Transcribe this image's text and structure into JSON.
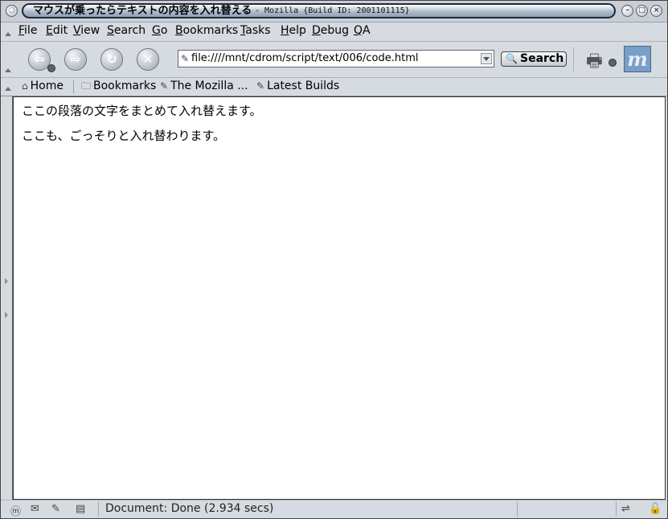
{
  "window": {
    "title": "マウスが乗ったらテキストの内容を入れ替える",
    "subtitle": "- Mozilla {Build ID: 2001101115}"
  },
  "menu": [
    {
      "label": "File",
      "accel": "F",
      "rest": "ile"
    },
    {
      "label": "Edit",
      "accel": "E",
      "rest": "dit"
    },
    {
      "label": "View",
      "accel": "V",
      "rest": "iew"
    },
    {
      "label": "Search",
      "accel": "S",
      "rest": "earch"
    },
    {
      "label": "Go",
      "accel": "G",
      "rest": "o"
    },
    {
      "label": "Bookmarks",
      "accel": "B",
      "rest": "ookmarks"
    },
    {
      "label": "Tasks",
      "accel": "T",
      "rest": "asks"
    },
    {
      "label": "Help",
      "accel": "H",
      "rest": "elp"
    },
    {
      "label": "Debug",
      "accel": "D",
      "rest": "ebug"
    },
    {
      "label": "QA",
      "accel": "Q",
      "rest": "A"
    }
  ],
  "navigation": {
    "url": "file:////mnt/cdrom/script/text/006/code.html",
    "search_label": "Search"
  },
  "personal_toolbar": {
    "home": "Home",
    "bookmarks": "Bookmarks",
    "mozilla": "The Mozilla ...",
    "latest_builds": "Latest Builds"
  },
  "content": {
    "paragraphs": [
      "ここの段落の文字をまとめて入れ替えます。",
      "ここも、ごっそりと入れ替わります。"
    ]
  },
  "status": {
    "text": "Document: Done (2.934 secs)"
  },
  "icons": {
    "back": "back-arrow-icon",
    "forward": "forward-arrow-icon",
    "reload": "reload-icon",
    "stop": "stop-icon",
    "print": "print-icon",
    "logo": "mozilla-logo"
  }
}
